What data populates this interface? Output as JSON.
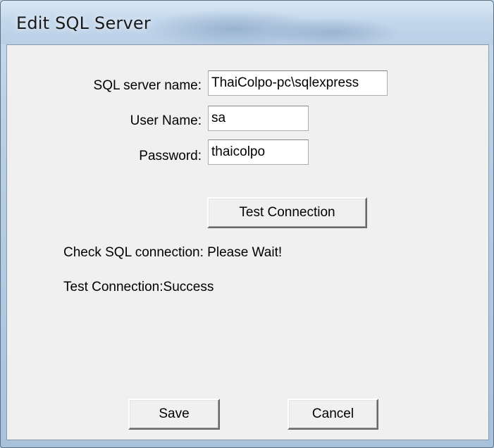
{
  "window": {
    "title": "Edit SQL Server"
  },
  "form": {
    "server_label": "SQL server name:",
    "server_value": "ThaiColpo-pc\\sqlexpress",
    "user_label": "User Name:",
    "user_value": "sa",
    "password_label": "Password:",
    "password_value": "thaicolpo"
  },
  "actions": {
    "test_connection_label": "Test Connection",
    "save_label": "Save",
    "cancel_label": "Cancel"
  },
  "status": {
    "check_message": "Check SQL connection: Please Wait!",
    "result_message": "Test Connection:Success"
  }
}
